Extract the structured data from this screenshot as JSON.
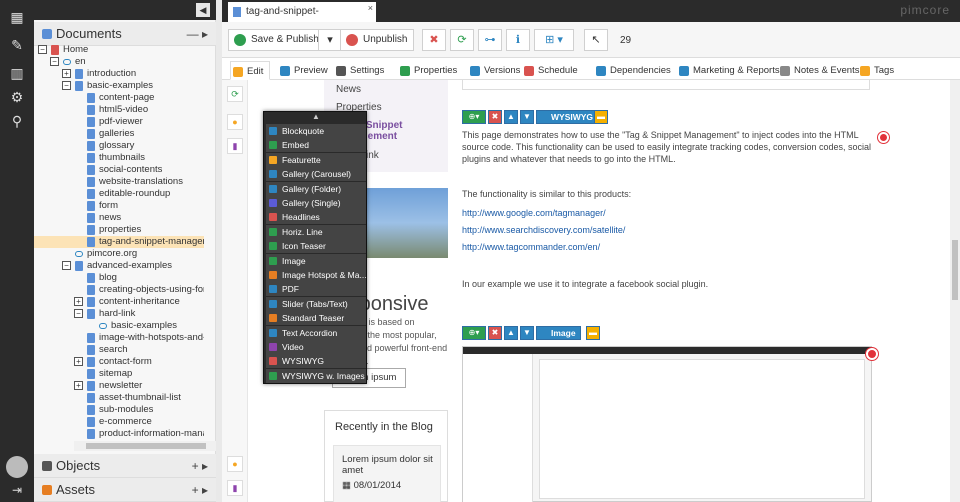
{
  "colors": {
    "accent": "#f5a623",
    "selected": "#fce3b6",
    "dark": "#2b2b2b",
    "link": "#1a5aa6",
    "primary_blue": "#2e86c1",
    "danger": "#d9534f",
    "success": "#2e9e4f"
  },
  "rail": {
    "icons": [
      "grid-icon",
      "wrench-icon",
      "chart-icon",
      "gear-icon",
      "search-icon"
    ],
    "glyphs": [
      "▦",
      "⚒",
      "▓",
      "⚙",
      "⌕"
    ]
  },
  "documents": {
    "title": "Documents",
    "controls": "— ▸"
  },
  "tree": [
    {
      "label": "Home",
      "indent": 0,
      "toggle": "−",
      "type": "home"
    },
    {
      "label": "en",
      "indent": 1,
      "toggle": "−",
      "type": "link"
    },
    {
      "label": "introduction",
      "indent": 2,
      "toggle": "+",
      "type": "doc"
    },
    {
      "label": "basic-examples",
      "indent": 2,
      "toggle": "−",
      "type": "doc"
    },
    {
      "label": "content-page",
      "indent": 3,
      "toggle": "",
      "type": "doc"
    },
    {
      "label": "html5-video",
      "indent": 3,
      "toggle": "",
      "type": "doc"
    },
    {
      "label": "pdf-viewer",
      "indent": 3,
      "toggle": "",
      "type": "doc"
    },
    {
      "label": "galleries",
      "indent": 3,
      "toggle": "",
      "type": "doc"
    },
    {
      "label": "glossary",
      "indent": 3,
      "toggle": "",
      "type": "doc"
    },
    {
      "label": "thumbnails",
      "indent": 3,
      "toggle": "",
      "type": "doc"
    },
    {
      "label": "social-contents",
      "indent": 3,
      "toggle": "",
      "type": "doc"
    },
    {
      "label": "website-translations",
      "indent": 3,
      "toggle": "",
      "type": "doc"
    },
    {
      "label": "editable-roundup",
      "indent": 3,
      "toggle": "",
      "type": "doc"
    },
    {
      "label": "form",
      "indent": 3,
      "toggle": "",
      "type": "doc"
    },
    {
      "label": "news",
      "indent": 3,
      "toggle": "",
      "type": "doc"
    },
    {
      "label": "properties",
      "indent": 3,
      "toggle": "",
      "type": "doc"
    },
    {
      "label": "tag-and-snippet-managem",
      "indent": 3,
      "toggle": "",
      "type": "doc",
      "selected": true
    },
    {
      "label": "pimcore.org",
      "indent": 2,
      "toggle": "",
      "type": "link"
    },
    {
      "label": "advanced-examples",
      "indent": 2,
      "toggle": "−",
      "type": "doc"
    },
    {
      "label": "blog",
      "indent": 3,
      "toggle": "",
      "type": "doc"
    },
    {
      "label": "creating-objects-using-form",
      "indent": 3,
      "toggle": "",
      "type": "doc"
    },
    {
      "label": "content-inheritance",
      "indent": 3,
      "toggle": "+",
      "type": "doc"
    },
    {
      "label": "hard-link",
      "indent": 3,
      "toggle": "−",
      "type": "doc"
    },
    {
      "label": "basic-examples",
      "indent": 4,
      "toggle": "",
      "type": "link"
    },
    {
      "label": "image-with-hotspots-and-r",
      "indent": 3,
      "toggle": "",
      "type": "doc"
    },
    {
      "label": "search",
      "indent": 3,
      "toggle": "",
      "type": "doc"
    },
    {
      "label": "contact-form",
      "indent": 3,
      "toggle": "+",
      "type": "doc"
    },
    {
      "label": "sitemap",
      "indent": 3,
      "toggle": "",
      "type": "doc"
    },
    {
      "label": "newsletter",
      "indent": 3,
      "toggle": "+",
      "type": "doc"
    },
    {
      "label": "asset-thumbnail-list",
      "indent": 3,
      "toggle": "",
      "type": "doc"
    },
    {
      "label": "sub-modules",
      "indent": 3,
      "toggle": "",
      "type": "doc"
    },
    {
      "label": "e-commerce",
      "indent": 3,
      "toggle": "",
      "type": "doc"
    },
    {
      "label": "product-information-mana",
      "indent": 3,
      "toggle": "",
      "type": "doc"
    }
  ],
  "objects": {
    "title": "Objects",
    "controls": "+ ▸"
  },
  "assets": {
    "title": "Assets",
    "controls": "+ ▸"
  },
  "tab": {
    "label": "tag-and-snippet-management",
    "close": "×"
  },
  "brand": "pimcore",
  "toolbar": {
    "save_publish": "Save & Publish",
    "unpublish": "Unpublish",
    "version": "29"
  },
  "edit_tabs": [
    {
      "label": "Edit",
      "color": "#f5a623"
    },
    {
      "label": "Preview",
      "color": "#2e86c1"
    },
    {
      "label": "Settings",
      "color": "#555555"
    },
    {
      "label": "Properties",
      "color": "#2e9e4f"
    },
    {
      "label": "Versions",
      "color": "#2e86c1"
    },
    {
      "label": "Schedule",
      "color": "#d9534f"
    },
    {
      "label": "Dependencies",
      "color": "#2e86c1"
    },
    {
      "label": "Marketing & Reports",
      "color": "#2e86c1"
    },
    {
      "label": "Notes & Events",
      "color": "#888888"
    },
    {
      "label": "Tags",
      "color": "#f5a623"
    }
  ],
  "page_nav": [
    "News",
    "Properties",
    "Tag & Snippet Management",
    "Hard Link"
  ],
  "page_left": {
    "responsive": "Fully Responsive",
    "demo": "This demo is based on Bootstrap, the most popular, intuitive and powerful front-end framework.",
    "lorem_button": "Lorem ipsum"
  },
  "blog": {
    "title": "Recently in the Blog",
    "post_title": "Lorem ipsum dolor sit amet",
    "post_date": "08/01/2014"
  },
  "wysiwyg_label": "WYSIWYG",
  "image_label": "Image",
  "body_text": {
    "p1": "This page demonstrates how to use the \"Tag & Snippet Management\" to inject codes into the HTML source code. This functionality can be used to easily integrate tracking codes, conversion codes, social plugins and whatever that needs to go into the HTML.",
    "p2": "The functionality is similar to this products:",
    "links": [
      "http://www.google.com/tagmanager/",
      "http://www.searchdiscovery.com/satellite/",
      "http://www.tagcommander.com/en/"
    ],
    "p3": "In our example we use it to integrate a facebook social plugin."
  },
  "menu_items": [
    {
      "label": "Blockquote",
      "color": "#2e86c1"
    },
    {
      "label": "Embed",
      "color": "#2e9e4f"
    },
    {
      "label": "Featurette",
      "color": "#f5a623"
    },
    {
      "label": "Gallery (Carousel)",
      "color": "#2e86c1"
    },
    {
      "label": "Gallery (Folder)",
      "color": "#2e86c1"
    },
    {
      "label": "Gallery (Single)",
      "color": "#5b5bd6"
    },
    {
      "label": "Headlines",
      "color": "#d9534f"
    },
    {
      "label": "Horiz. Line",
      "color": "#2e9e4f"
    },
    {
      "label": "Icon Teaser",
      "color": "#2e9e4f"
    },
    {
      "label": "Image",
      "color": "#2e9e4f"
    },
    {
      "label": "Image Hotspot & Ma...",
      "color": "#e67e22"
    },
    {
      "label": "PDF",
      "color": "#2e86c1"
    },
    {
      "label": "Slider (Tabs/Text)",
      "color": "#2e86c1"
    },
    {
      "label": "Standard Teaser",
      "color": "#e67e22"
    },
    {
      "label": "Text Accordion",
      "color": "#2e86c1"
    },
    {
      "label": "Video",
      "color": "#8e44ad"
    },
    {
      "label": "WYSIWYG",
      "color": "#d9534f"
    },
    {
      "label": "WYSIWYG w. Images",
      "color": "#2e9e4f"
    }
  ]
}
